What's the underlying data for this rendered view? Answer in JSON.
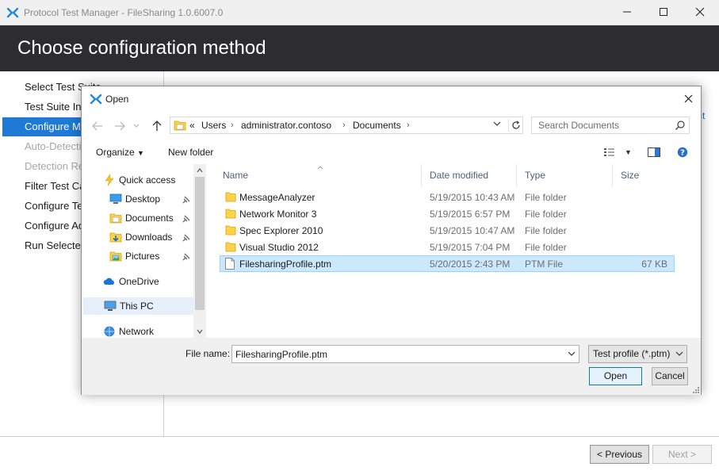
{
  "window": {
    "title": "Protocol Test Manager - FileSharing 1.0.6007.0"
  },
  "header": {
    "title": "Choose configuration method"
  },
  "sidebar": {
    "items": [
      {
        "label": "Select Test Suite",
        "state": "normal"
      },
      {
        "label": "Test Suite Introduction",
        "state": "normal"
      },
      {
        "label": "Configure Method",
        "state": "active"
      },
      {
        "label": "Auto-Detection",
        "state": "disabled"
      },
      {
        "label": "Detection Result",
        "state": "disabled"
      },
      {
        "label": "Filter Test Cases",
        "state": "normal"
      },
      {
        "label": "Configure Test Cases",
        "state": "normal"
      },
      {
        "label": "Configure Adapter",
        "state": "normal"
      },
      {
        "label": "Run Selected Test Cases",
        "state": "normal"
      }
    ]
  },
  "main": {
    "link_fragment": "ct"
  },
  "footer": {
    "previous_label": "< Previous",
    "next_label": "Next >"
  },
  "dialog": {
    "title": "Open",
    "address": {
      "overflow": "«",
      "crumbs": [
        "Users",
        "administrator.contoso",
        "Documents"
      ]
    },
    "search": {
      "placeholder": "Search Documents"
    },
    "toolbar": {
      "organize_label": "Organize",
      "new_folder_label": "New folder"
    },
    "tree": {
      "quick_access": "Quick access",
      "pinned": [
        "Desktop",
        "Documents",
        "Downloads",
        "Pictures"
      ],
      "onedrive": "OneDrive",
      "this_pc": "This PC",
      "network": "Network"
    },
    "columns": {
      "name": "Name",
      "date": "Date modified",
      "type": "Type",
      "size": "Size"
    },
    "files": [
      {
        "name": "MessageAnalyzer",
        "date": "5/19/2015 10:43 AM",
        "type": "File folder",
        "size": "",
        "kind": "folder"
      },
      {
        "name": "Network Monitor 3",
        "date": "5/19/2015 6:57 PM",
        "type": "File folder",
        "size": "",
        "kind": "folder"
      },
      {
        "name": "Spec Explorer 2010",
        "date": "5/19/2015 10:47 AM",
        "type": "File folder",
        "size": "",
        "kind": "folder"
      },
      {
        "name": "Visual Studio 2012",
        "date": "5/19/2015 7:04 PM",
        "type": "File folder",
        "size": "",
        "kind": "folder"
      },
      {
        "name": "FilesharingProfile.ptm",
        "date": "5/20/2015 2:43 PM",
        "type": "PTM File",
        "size": "67 KB",
        "kind": "file"
      }
    ],
    "file_name_label": "File name:",
    "file_name_value": "FilesharingProfile.ptm",
    "file_type_value": "Test profile (*.ptm)",
    "open_label": "Open",
    "cancel_label": "Cancel"
  },
  "colors": {
    "accent": "#1e7ad6",
    "header_bg": "#2d2d30",
    "folder": "#ffd24a",
    "selection": "#cce8ff"
  }
}
